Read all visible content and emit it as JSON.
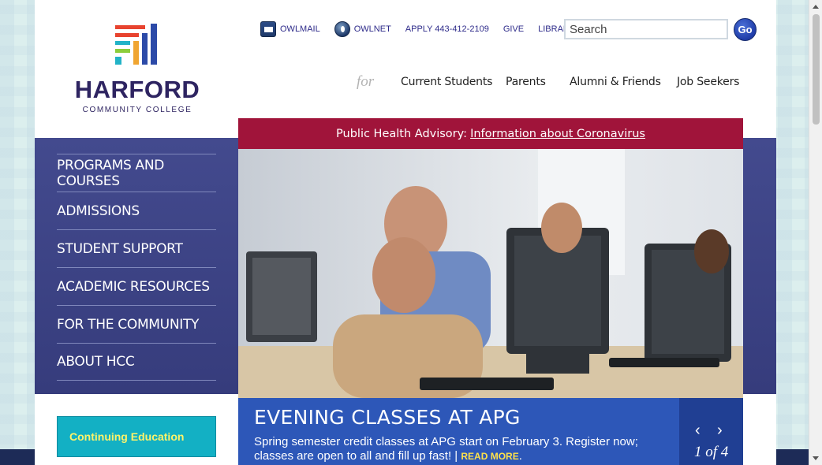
{
  "logo": {
    "name": "HARFORD",
    "subtitle": "COMMUNITY COLLEGE",
    "colors": [
      "#e8432f",
      "#2c4aa8",
      "#22b3c7",
      "#8ccd3b",
      "#f0a531",
      "#2e2461"
    ]
  },
  "utility": [
    {
      "label": "OWLMAIL",
      "icon": "owlmail-icon"
    },
    {
      "label": "OWLNET",
      "icon": "owlnet-icon"
    },
    {
      "label": "APPLY 443-412-2109"
    },
    {
      "label": "GIVE"
    },
    {
      "label": "LIBRARY"
    }
  ],
  "search": {
    "placeholder": "Search",
    "button": "Go"
  },
  "audience": {
    "for_label": "for",
    "items": [
      "Current Students",
      "Parents",
      "Alumni & Friends",
      "Job Seekers"
    ]
  },
  "sidebar": {
    "items": [
      "PROGRAMS AND COURSES",
      "ADMISSIONS",
      "STUDENT SUPPORT",
      "ACADEMIC RESOURCES",
      "FOR THE COMMUNITY",
      "ABOUT HCC"
    ],
    "cta": "Continuing Education"
  },
  "advisory": {
    "prefix": "Public Health Advisory:",
    "link": "Information about Coronavirus"
  },
  "slide": {
    "title": "EVENING CLASSES AT APG",
    "text": "Spring semester credit classes at APG start on February 3. Register now; classes are open to all and fill up fast! |",
    "more": "READ MORE",
    "counter": "1 of 4"
  },
  "colors": {
    "brand_navy": "#2e2461",
    "advisory_red": "#a0143a",
    "menu_purple": "#3e4587",
    "caption_blue": "#2d57b8",
    "cta_teal": "#13b0c4"
  }
}
